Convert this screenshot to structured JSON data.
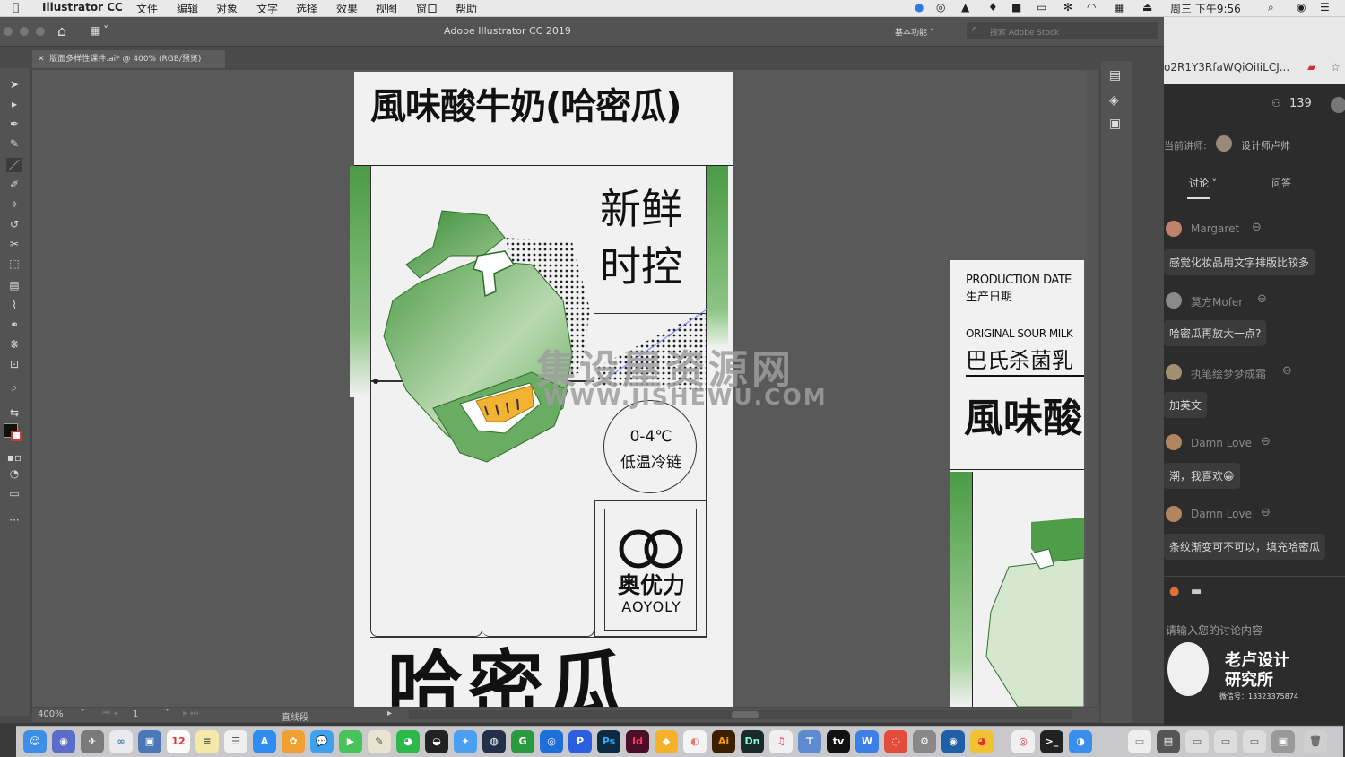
{
  "menubar": {
    "app_name": "Illustrator CC",
    "items": [
      "文件",
      "编辑",
      "对象",
      "文字",
      "选择",
      "效果",
      "视图",
      "窗口",
      "帮助"
    ],
    "clock": "周三 下午9:56"
  },
  "window": {
    "title": "Adobe Illustrator CC 2019",
    "workspace": "基本功能",
    "search_placeholder": "搜索 Adobe Stock"
  },
  "document_tab": {
    "label": "版面多样性课件.ai* @ 400% (RGB/预览)"
  },
  "statusbar": {
    "zoom": "400%",
    "artboard": "1",
    "tool_name": "直线段"
  },
  "artboard_main": {
    "title": "風味酸牛奶(哈密瓜)",
    "fresh_line1": "新鲜",
    "fresh_line2": "时控",
    "temp": "0-4℃",
    "cold_chain": "低温冷链",
    "brand_cn": "奥优力",
    "brand_en": "AOYOLY",
    "bottom_title": "哈密瓜"
  },
  "artboard_side": {
    "prod_date_en": "PRODUCTION DATE",
    "prod_date_cn": "生产日期",
    "original_en": "ORIGINAL SOUR MILK",
    "original_cn": "巴氏杀菌乳",
    "partial_title": "風味酸"
  },
  "watermark": {
    "line1": "集设屋资源网",
    "line2": "WWW.JISHEWU.COM"
  },
  "chat": {
    "url": "o2R1Y3RfaWQiOiIiLCJ...",
    "viewer_count": "139",
    "lecturer_label": "当前讲师:",
    "lecturer_name": "设计师卢帅",
    "tab_discuss": "讨论",
    "tab_qa": "问答",
    "messages": [
      {
        "user": "Margaret",
        "text": "感觉化妆品用文字排版比较多"
      },
      {
        "user": "莫方Mofer",
        "text": "哈密瓜再放大一点?"
      },
      {
        "user": "执笔绘梦梦成霜",
        "text": "加英文"
      },
      {
        "user": "Damn Love",
        "text": "潮，我喜欢😁"
      },
      {
        "user": "Damn Love",
        "text": "条纹渐变可不可以，填充哈密瓜"
      }
    ],
    "input_placeholder": "请输入您的讨论内容",
    "logo_line1": "老卢设计",
    "logo_line2": "研究所",
    "wechat": "微信号：13323375874"
  },
  "dock_apps": [
    "Ps",
    "Id",
    "Ai",
    "Dn"
  ],
  "colors": {
    "green": "#5fa855",
    "green_dark": "#3e8a3a",
    "melon_orange": "#f2b232"
  }
}
